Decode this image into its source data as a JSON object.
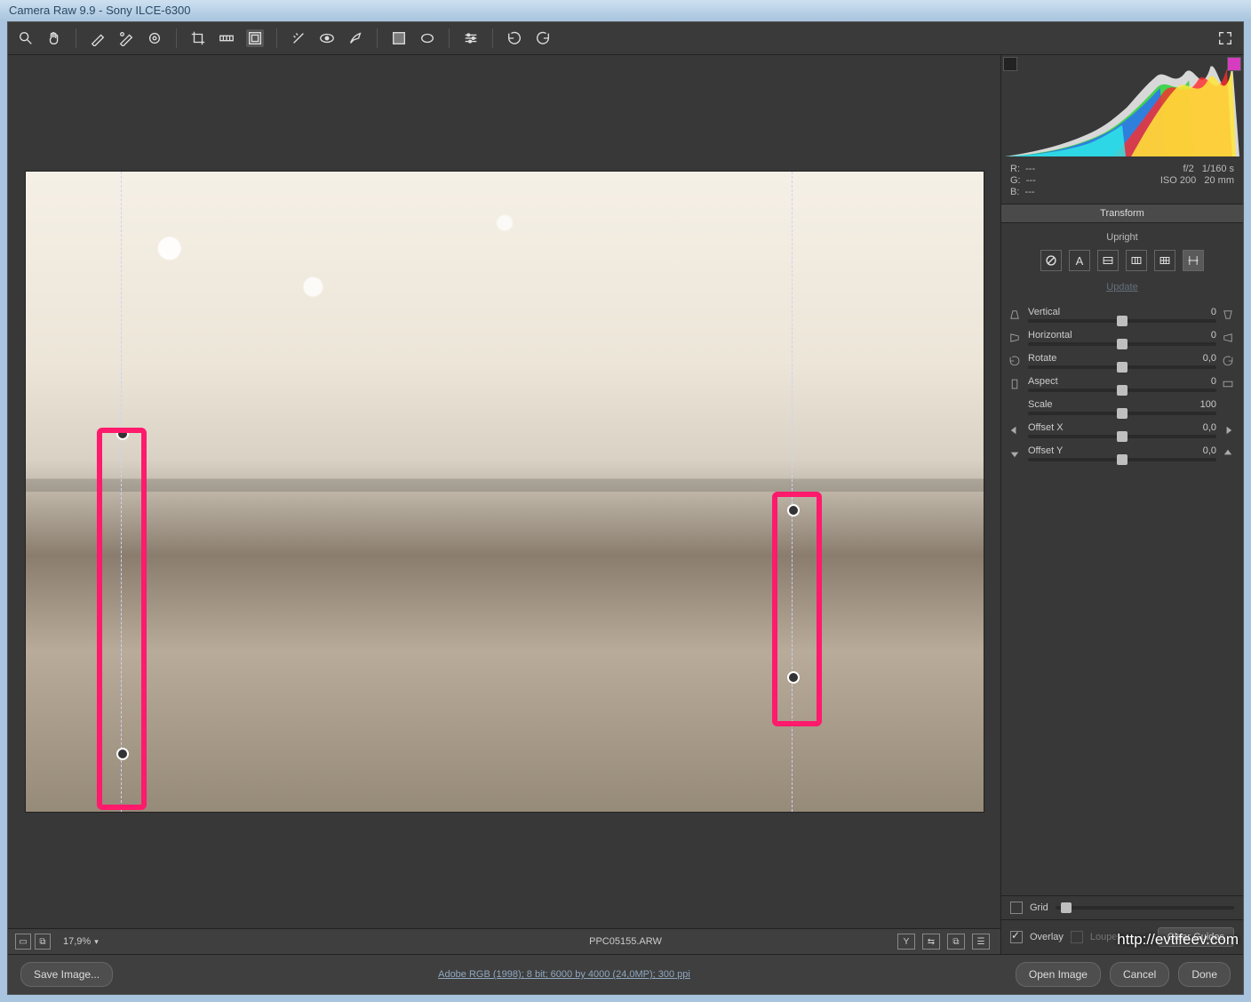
{
  "titlebar": "Camera Raw 9.9  -  Sony ILCE-6300",
  "rgb": {
    "r": "R:",
    "g": "G:",
    "b": "B:",
    "rv": "---",
    "gv": "---",
    "bv": "---"
  },
  "exif": {
    "line1a": "f/2",
    "line1b": "1/160 s",
    "line2a": "ISO 200",
    "line2b": "20 mm"
  },
  "panel_tab": "Transform",
  "upright": {
    "label": "Upright",
    "update": "Update"
  },
  "sliders": {
    "vertical": {
      "label": "Vertical",
      "value": "0",
      "pos": 50
    },
    "horizontal": {
      "label": "Horizontal",
      "value": "0",
      "pos": 50
    },
    "rotate": {
      "label": "Rotate",
      "value": "0,0",
      "pos": 50
    },
    "aspect": {
      "label": "Aspect",
      "value": "0",
      "pos": 50
    },
    "scale": {
      "label": "Scale",
      "value": "100",
      "pos": 50
    },
    "offsetx": {
      "label": "Offset X",
      "value": "0,0",
      "pos": 50
    },
    "offsety": {
      "label": "Offset Y",
      "value": "0,0",
      "pos": 50
    }
  },
  "grid_label": "Grid",
  "overlay_label": "Overlay",
  "loupe_label": "Loupe",
  "clear_guides": "Clear Guides",
  "zoom": "17,9%",
  "filename": "PPC05155.ARW",
  "workflow": "Adobe RGB (1998); 8 bit; 6000 by 4000 (24,0MP); 300 ppi",
  "save": "Save Image...",
  "open": "Open Image",
  "cancel": "Cancel",
  "done": "Done",
  "watermark": "http://evtifeev.com"
}
